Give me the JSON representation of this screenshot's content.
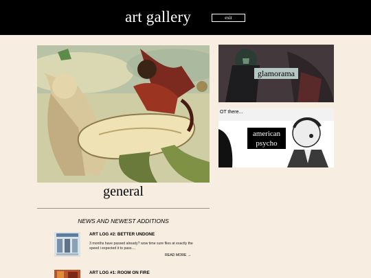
{
  "header": {
    "title": "art gallery",
    "exit_label": "exit"
  },
  "gallery": {
    "main": {
      "label": "general"
    },
    "cards": [
      {
        "label": "glamorama"
      },
      {
        "label": "american psycho",
        "caption_fragment": "OT there..."
      }
    ]
  },
  "news": {
    "heading": "NEWS AND NEWEST ADDITIONS",
    "posts": [
      {
        "title": "ART LOG #2: BETTER UNDONE",
        "excerpt": "3 months have passed already? wow time sure flies at exactly the speed i expected it to pass....",
        "read_more": "READ MORE →"
      },
      {
        "title": "ART LOG #1: ROOM ON FIRE"
      }
    ]
  },
  "colors": {
    "background": "#f8ede1",
    "header": "#000000"
  }
}
